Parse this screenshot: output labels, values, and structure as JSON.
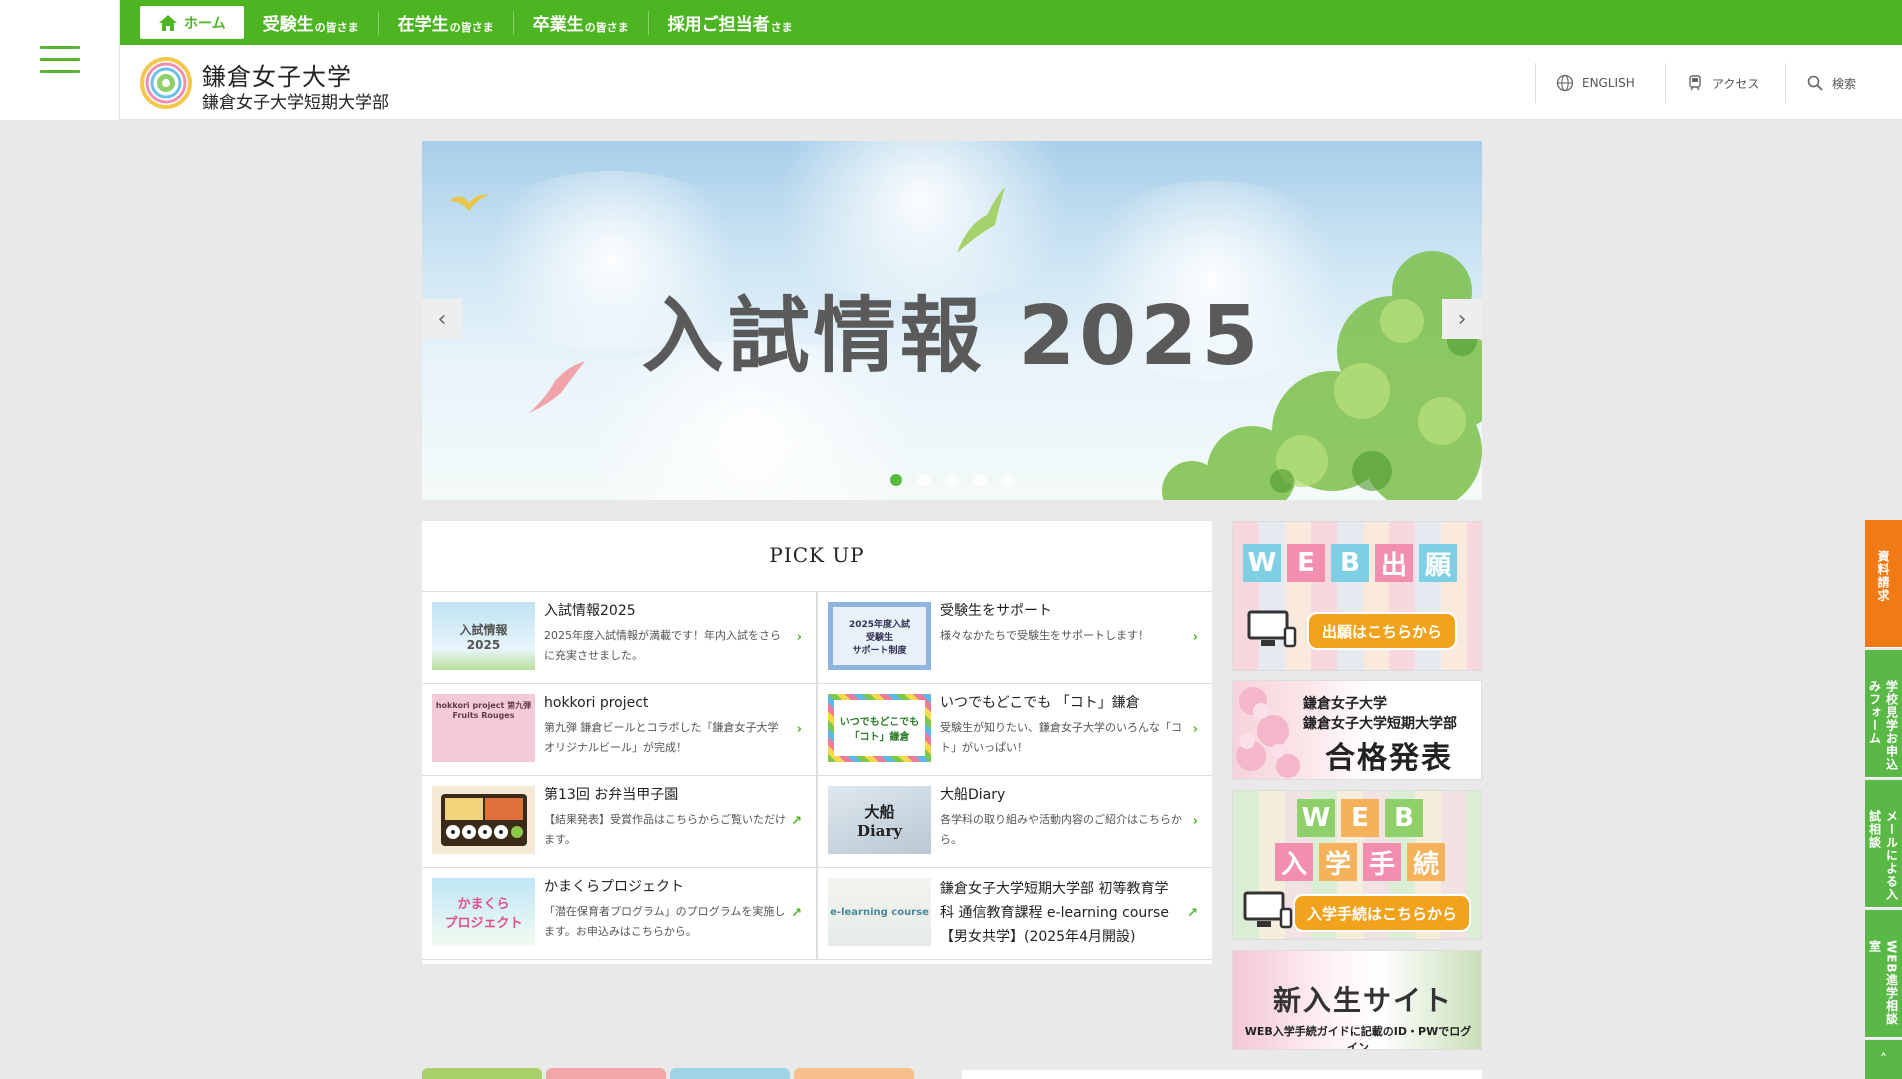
{
  "nav": {
    "home": "ホーム",
    "items": [
      {
        "main": "受験生",
        "small": "の皆さま"
      },
      {
        "main": "在学生",
        "small": "の皆さま"
      },
      {
        "main": "卒業生",
        "small": "の皆さま"
      },
      {
        "main": "採用ご担当者",
        "small": "さま"
      }
    ]
  },
  "header": {
    "name": "鎌倉女子大学",
    "sub": "鎌倉女子大学短期大学部",
    "english": "ENGLISH",
    "access": "アクセス",
    "search": "検索"
  },
  "hero": {
    "title": "入試情報 2025",
    "slide_count": 5,
    "active_slide": 1
  },
  "pickup": {
    "title": "PICK UP",
    "items": [
      {
        "title": "入試情報2025",
        "desc": "2025年度入試情報が満載です！年内入試をさらに充実させました。",
        "thumb": "入試情報\n2025",
        "link": "arrow"
      },
      {
        "title": "受験生をサポート",
        "desc": "様々なかたちで受験生をサポートします！",
        "thumb": "2025年度入試\n受験生\nサポート制度",
        "link": "arrow"
      },
      {
        "title": "hokkori project",
        "desc": "第九弾 鎌倉ビールとコラボした「鎌倉女子大学オリジナルビール」が完成！",
        "thumb": "hokkori project 第九弾\nFruits Rouges",
        "link": "arrow"
      },
      {
        "title": "いつでもどこでも 「コト」鎌倉",
        "desc": "受験生が知りたい、鎌倉女子大学のいろんな「コト」がいっぱい！",
        "thumb": "いつでもどこでも\n「コト」鎌倉",
        "link": "arrow"
      },
      {
        "title": "第13回 お弁当甲子園",
        "desc": "【結果発表】受賞作品はこちらからご覧いただけます。",
        "thumb": "",
        "link": "external"
      },
      {
        "title": "大船Diary",
        "desc": "各学科の取り組みや活動内容のご紹介はこちらから。",
        "thumb": "大船\nDiary",
        "link": "arrow"
      },
      {
        "title": "かまくらプロジェクト",
        "desc": "「潜在保育者プログラム」のプログラムを実施します。お申込みはこちらから。",
        "thumb": "かまくら\nプロジェクト",
        "link": "external"
      },
      {
        "title": "鎌倉女子大学短期大学部 初等教育学科 通信教育課程 e-learning course 【男女共学】(2025年4月開設)",
        "desc": "",
        "thumb": "e-learning course",
        "link": "external"
      }
    ]
  },
  "banners": {
    "web_apply": {
      "tiles": [
        "W",
        "E",
        "B",
        "出",
        "願"
      ],
      "button": "出願はこちらから"
    },
    "pass": {
      "line1": "鎌倉女子大学",
      "line2": "鎌倉女子大学短期大学部",
      "line3": "合格発表"
    },
    "web_proc": {
      "tiles_top": [
        "W",
        "E",
        "B"
      ],
      "tiles_bottom": [
        "入",
        "学",
        "手",
        "続"
      ],
      "button": "入学手続はこちらから"
    },
    "new_student": {
      "title": "新入生サイト",
      "sub": "WEB入学手続ガイドに記載のID・PWでログイン"
    }
  },
  "side_tabs": [
    "資料請求",
    "学校見学お申込みフォーム",
    "メールによる入試相談",
    "WEB進学相談室"
  ],
  "colors": {
    "green": "#4cb521",
    "orange": "#f07a16",
    "tab_green": "#5ab946"
  }
}
